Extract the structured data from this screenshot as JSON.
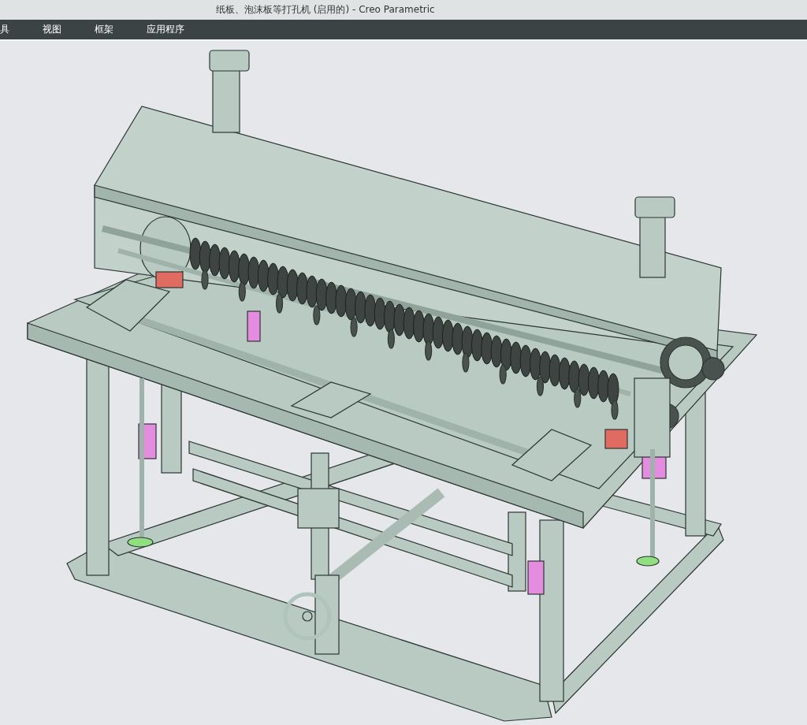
{
  "window": {
    "title": "纸板、泡沫板等打孔机 (启用的) - Creo Parametric"
  },
  "menu": [
    {
      "label": "具"
    },
    {
      "label": "视图"
    },
    {
      "label": "框架"
    },
    {
      "label": "应用程序"
    }
  ]
}
